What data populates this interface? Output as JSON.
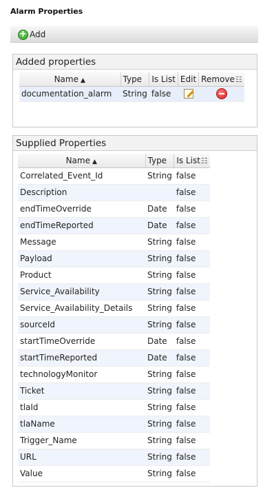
{
  "page": {
    "title": "Alarm Properties"
  },
  "toolbar": {
    "add_label": "Add"
  },
  "added": {
    "header": "Added properties",
    "columns": {
      "name": "Name",
      "type": "Type",
      "is_list": "Is List",
      "edit": "Edit",
      "remove": "Remove"
    },
    "rows": [
      {
        "name": "documentation_alarm",
        "type": "String",
        "is_list": "false"
      }
    ]
  },
  "supplied": {
    "header": "Supplied Properties",
    "columns": {
      "name": "Name",
      "type": "Type",
      "is_list": "Is List"
    },
    "rows": [
      {
        "name": "Correlated_Event_Id",
        "type": "String",
        "is_list": "false"
      },
      {
        "name": "Description",
        "type": "",
        "is_list": "false"
      },
      {
        "name": "endTimeOverride",
        "type": "Date",
        "is_list": "false"
      },
      {
        "name": "endTimeReported",
        "type": "Date",
        "is_list": "false"
      },
      {
        "name": "Message",
        "type": "String",
        "is_list": "false"
      },
      {
        "name": "Payload",
        "type": "String",
        "is_list": "false"
      },
      {
        "name": "Product",
        "type": "String",
        "is_list": "false"
      },
      {
        "name": "Service_Availability",
        "type": "String",
        "is_list": "false"
      },
      {
        "name": "Service_Availability_Details",
        "type": "String",
        "is_list": "false"
      },
      {
        "name": "sourceId",
        "type": "String",
        "is_list": "false"
      },
      {
        "name": "startTimeOverride",
        "type": "Date",
        "is_list": "false"
      },
      {
        "name": "startTimeReported",
        "type": "Date",
        "is_list": "false"
      },
      {
        "name": "technologyMonitor",
        "type": "String",
        "is_list": "false"
      },
      {
        "name": "Ticket",
        "type": "String",
        "is_list": "false"
      },
      {
        "name": "tlaId",
        "type": "String",
        "is_list": "false"
      },
      {
        "name": "tlaName",
        "type": "String",
        "is_list": "false"
      },
      {
        "name": "Trigger_Name",
        "type": "String",
        "is_list": "false"
      },
      {
        "name": "URL",
        "type": "String",
        "is_list": "false"
      },
      {
        "name": "Value",
        "type": "String",
        "is_list": "false"
      }
    ]
  }
}
